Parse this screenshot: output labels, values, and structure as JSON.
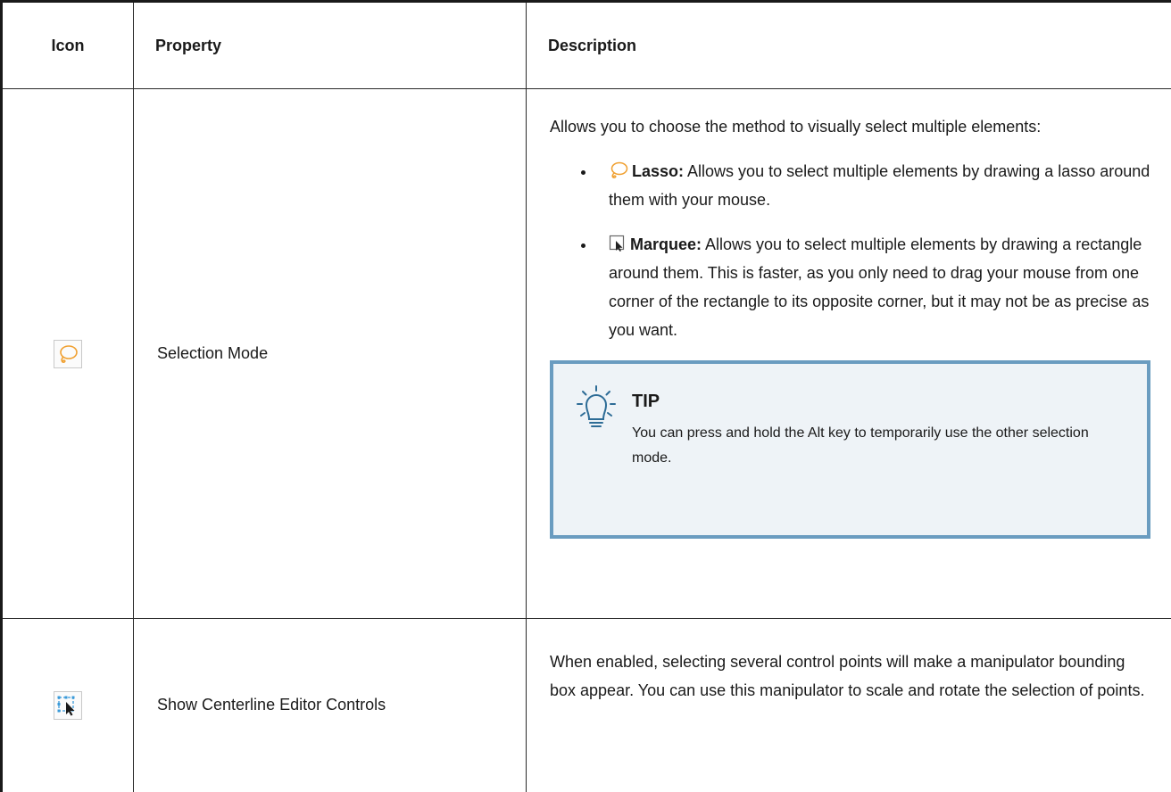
{
  "table": {
    "headers": {
      "icon": "Icon",
      "property": "Property",
      "description": "Description"
    },
    "rows": [
      {
        "icon": "lasso-icon",
        "property": "Selection Mode",
        "description_intro": "Allows you to choose the method to visually select multiple elements:",
        "modes": [
          {
            "icon": "lasso-icon",
            "term": "Lasso:",
            "text": "Allows you to select multiple elements by drawing a lasso around them with your mouse."
          },
          {
            "icon": "marquee-icon",
            "term": "Marquee:",
            "text": "Allows you to select multiple elements by drawing a rectangle around them. This is faster, as you only need to drag your mouse from one corner of the rectangle to its opposite corner, but it may not be as precise as you want."
          }
        ],
        "tip": {
          "icon": "lightbulb-icon",
          "title": "TIP",
          "text": "You can press and hold the Alt key to temporarily use the other selection mode."
        }
      },
      {
        "icon": "centerline-editor-icon",
        "property": "Show Centerline Editor Controls",
        "description": "When enabled, selecting several control points will make a manipulator bounding box appear. You can use this manipulator to scale and rotate the selection of points."
      }
    ]
  },
  "colors": {
    "lasso": "#f0a030",
    "tip_border": "#6a9cc0",
    "tip_bg": "#eef3f7",
    "selection_blue": "#3a9ad9"
  }
}
